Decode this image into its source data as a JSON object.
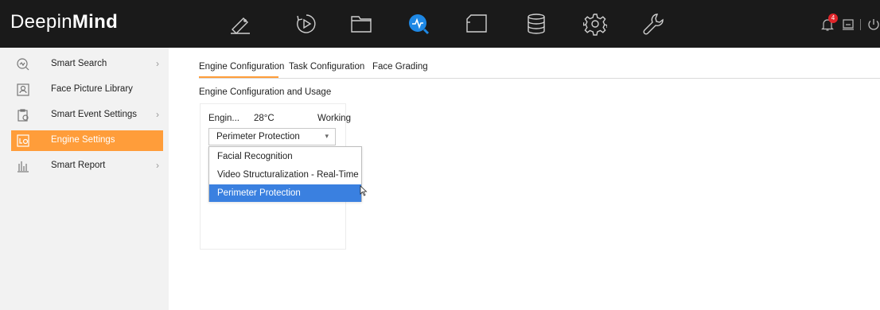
{
  "app": {
    "logo_regular": "Deepin",
    "logo_bold": "Mind",
    "notification_count": "4"
  },
  "topnav": {
    "icons": [
      "camera-icon",
      "playback-icon",
      "folder-icon",
      "smart-analysis-icon",
      "tag-icon",
      "storage-icon",
      "settings-icon",
      "maintenance-icon"
    ],
    "active_icon": "smart-analysis-icon",
    "accent": "#1e88e5"
  },
  "sidebar": {
    "items": [
      {
        "label": "Smart Search",
        "icon": "smart-search-icon",
        "has_submenu": true
      },
      {
        "label": "Face Picture Library",
        "icon": "face-library-icon",
        "has_submenu": false
      },
      {
        "label": "Smart Event Settings",
        "icon": "event-settings-icon",
        "has_submenu": true
      },
      {
        "label": "Engine Settings",
        "icon": "engine-settings-icon",
        "has_submenu": false,
        "active": true
      },
      {
        "label": "Smart Report",
        "icon": "report-icon",
        "has_submenu": true
      }
    ],
    "active_color": "#ff9d3a"
  },
  "tabs": [
    {
      "label": "Engine Configuration",
      "active": true
    },
    {
      "label": "Task Configuration"
    },
    {
      "label": "Face Grading"
    }
  ],
  "section_title": "Engine Configuration and Usage",
  "engine_card": {
    "name": "Engin...",
    "temperature": "28°C",
    "status": "Working",
    "select_value": "Perimeter Protection"
  },
  "dropdown": {
    "options": [
      "Facial Recognition",
      "Video Structuralization - Real-Time",
      "Perimeter Protection"
    ],
    "selected_index": 2,
    "highlight_color": "#3a80e0"
  }
}
